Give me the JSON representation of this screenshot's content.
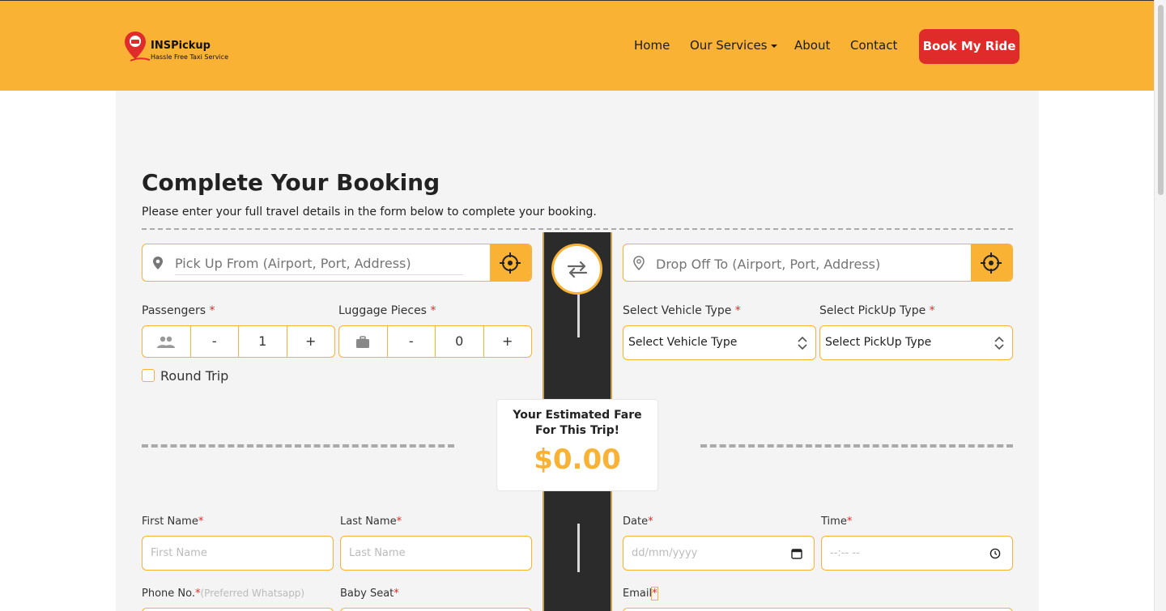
{
  "brand": {
    "name": "INSPickup",
    "tagline": "Hassle Free Taxi Service"
  },
  "nav": {
    "home": "Home",
    "services": "Our Services",
    "about": "About",
    "contact": "Contact",
    "book": "Book My Ride"
  },
  "booking": {
    "title": "Complete Your Booking",
    "subtitle": "Please enter your full travel details in the form below to complete your booking.",
    "pickup_placeholder": "Pick Up From (Airport, Port, Address)",
    "dropoff_placeholder": "Drop Off To (Airport, Port, Address)",
    "passengers_label": "Passengers",
    "luggage_label": "Luggage Pieces",
    "vehicle_label": "Select Vehicle Type",
    "pickup_type_label": "Select PickUp Type",
    "required_mark": "*",
    "minus": "-",
    "plus": "+",
    "passengers_value": "1",
    "luggage_value": "0",
    "vehicle_selected": "Select Vehicle Type",
    "pickup_type_selected": "Select PickUp Type",
    "round_trip_label": "Round Trip"
  },
  "fare": {
    "title": "Your Estimated Fare For This Trip!",
    "amount": "$0.00"
  },
  "details": {
    "first_name_label": "First Name",
    "first_name_placeholder": "First Name",
    "last_name_label": "Last Name",
    "last_name_placeholder": "Last Name",
    "date_label": "Date",
    "date_placeholder": "dd/mm/yyyy",
    "time_label": "Time",
    "time_placeholder": "--:-- --",
    "phone_label": "Phone No.",
    "phone_hint": "(Preferred Whatsapp)",
    "baby_seat_label": "Baby Seat",
    "email_label": "Email"
  },
  "colors": {
    "accent": "#f9b233",
    "danger": "#e02b2b",
    "panel": "#f4f4f4"
  }
}
